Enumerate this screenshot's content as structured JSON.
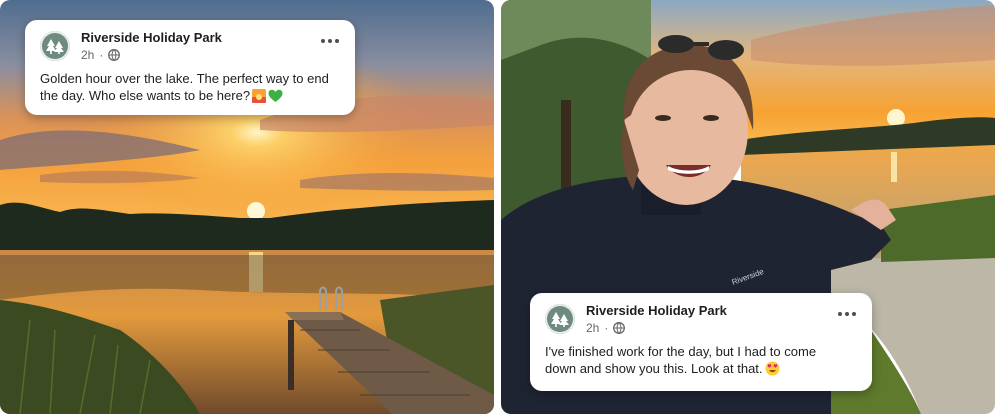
{
  "left_post": {
    "page_name": "Riverside Holiday Park",
    "time": "2h",
    "separator": "·",
    "privacy_icon": "globe-icon",
    "text": "Golden hour over the lake. The perfect way to end\nthe day. Who else wants to be here?",
    "emojis": [
      "sunset-emoji",
      "green-heart-emoji"
    ]
  },
  "right_post": {
    "page_name": "Riverside Holiday Park",
    "time": "2h",
    "separator": "·",
    "privacy_icon": "globe-icon",
    "text": "I've finished work for the day, but I had to come\ndown and show you this. Look at that.",
    "emojis": [
      "heart-eyes-emoji"
    ]
  },
  "avatar_icon": "pine-trees-logo",
  "more_icon": "more-options-icon",
  "colors": {
    "card_background": "#ffffff",
    "name_text": "#1c1e21",
    "meta_text": "#65676b",
    "avatar": "#6f8a7f",
    "sunset_orange": "#f7a233"
  }
}
